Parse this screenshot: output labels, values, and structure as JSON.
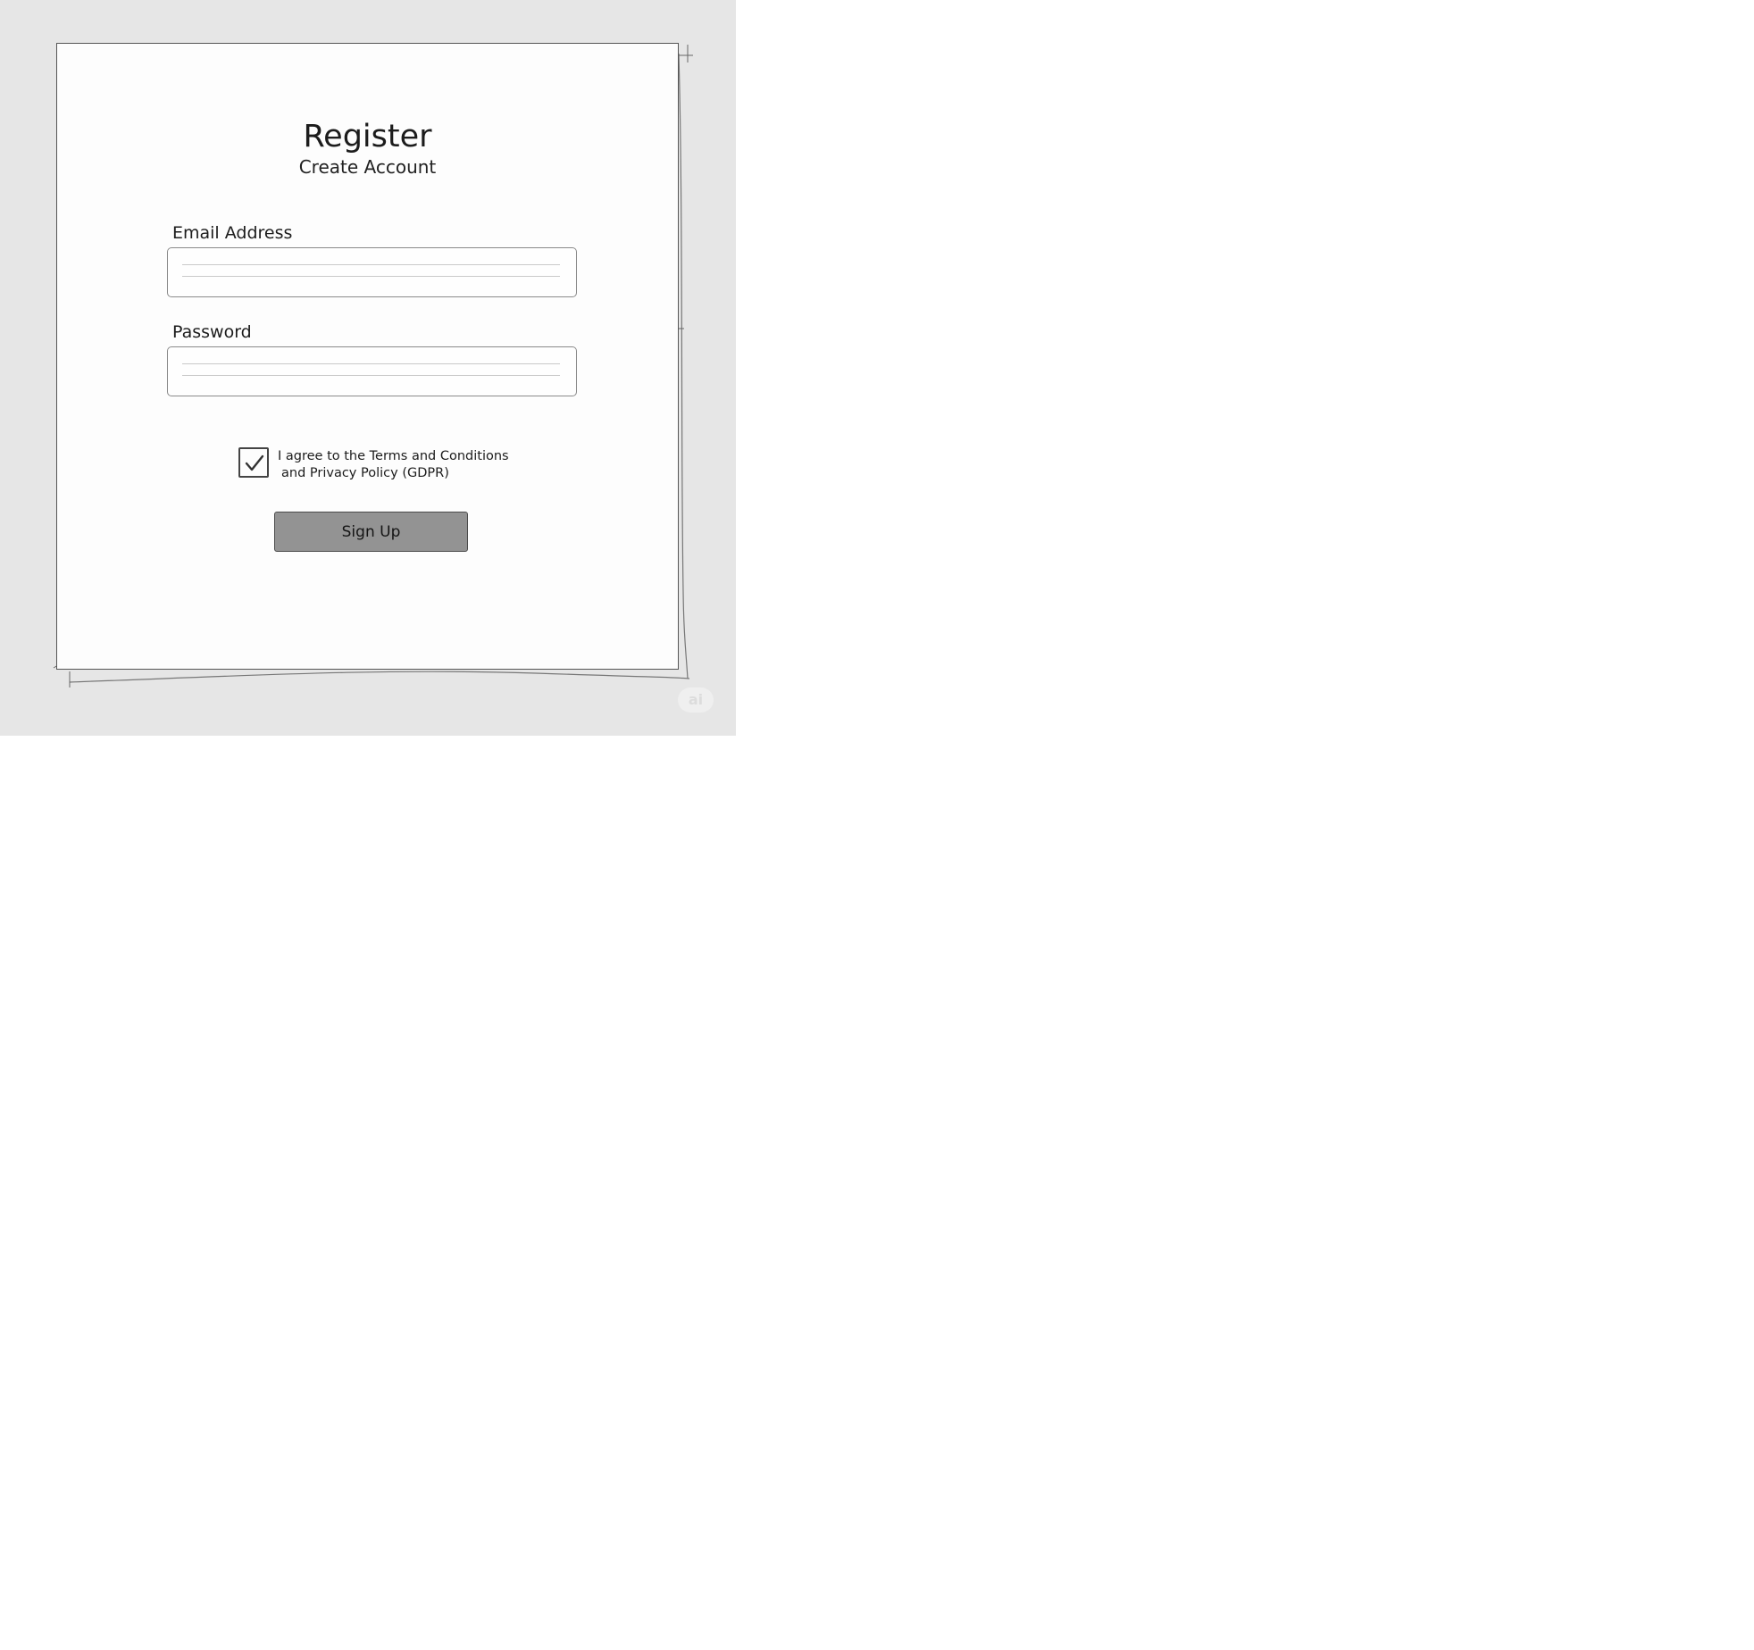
{
  "form": {
    "title": "Register",
    "subtitle": "Create Account",
    "email_label": "Email Address",
    "email_value": "",
    "password_label": "Password",
    "password_value": "",
    "agree_line1": "I agree to the Terms and Conditions",
    "agree_line2": "and Privacy Policy (GDPR)",
    "agree_checked": true,
    "signup_label": "Sign Up"
  },
  "watermark": {
    "text": "ai"
  },
  "colors": {
    "background": "#e6e6e6",
    "card": "#fdfdfd",
    "button": "#939393",
    "border": "#555555"
  },
  "icons": {
    "checkbox": "checkmark-icon"
  }
}
